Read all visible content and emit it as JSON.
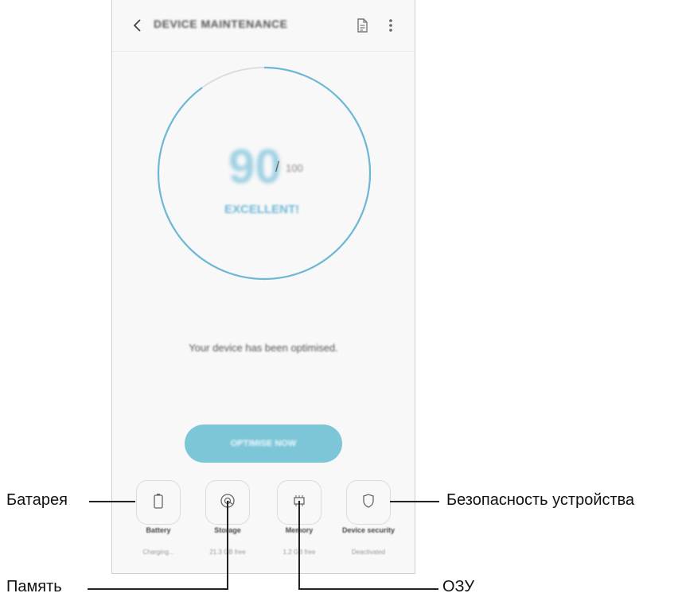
{
  "app": {
    "title": "DEVICE MAINTENANCE"
  },
  "score": {
    "value": "90",
    "slash": "/",
    "max": "100",
    "status": "EXCELLENT!",
    "progress": 0.9
  },
  "message": "Your device has been optimised.",
  "optimise_button": "OPTIMISE NOW",
  "tiles": [
    {
      "label": "Battery",
      "sub": "Charging...",
      "icon": "battery-icon"
    },
    {
      "label": "Storage",
      "sub": "21.3 GB free",
      "icon": "storage-icon"
    },
    {
      "label": "Memory",
      "sub": "1.2 GB free",
      "icon": "memory-icon"
    },
    {
      "label": "Device security",
      "sub": "Deactivated",
      "icon": "shield-icon"
    }
  ],
  "callouts": {
    "battery": "Батарея",
    "storage": "Память",
    "memory": "ОЗУ",
    "security": "Безопасность устройства"
  },
  "colors": {
    "ring": "#6db8d6",
    "ring_track": "#dddddd",
    "button": "#7dc6d8"
  }
}
